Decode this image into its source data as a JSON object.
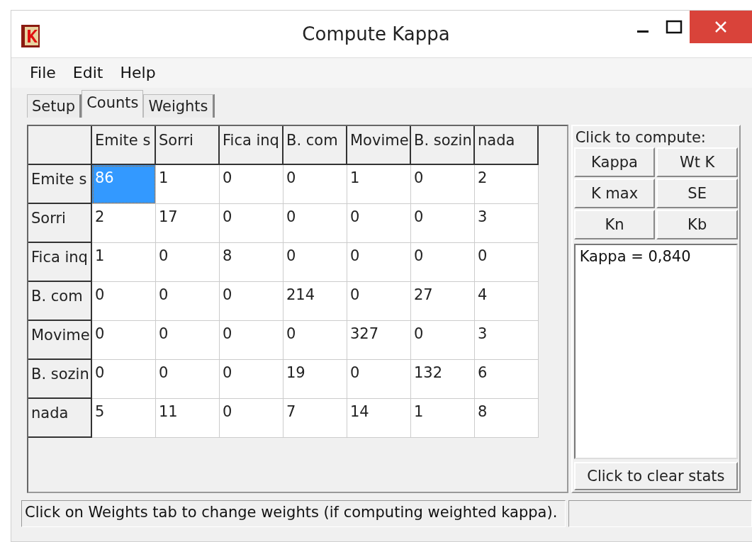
{
  "window": {
    "title": "Compute Kappa"
  },
  "menu": [
    "File",
    "Edit",
    "Help"
  ],
  "tabs": [
    {
      "label": "Setup",
      "selected": false
    },
    {
      "label": "Counts",
      "selected": true
    },
    {
      "label": "Weights",
      "selected": false
    }
  ],
  "grid": {
    "columns": [
      "Emite s",
      "Sorri",
      "Fica inq",
      "B. com",
      "Movime",
      "B. sozin",
      "nada"
    ],
    "rows": [
      {
        "header": "Emite s",
        "cells": [
          {
            "value": "86",
            "selected": true
          },
          {
            "value": "1",
            "selected": false
          },
          {
            "value": "0",
            "selected": false
          },
          {
            "value": "0",
            "selected": false
          },
          {
            "value": "1",
            "selected": false
          },
          {
            "value": "0",
            "selected": false
          },
          {
            "value": "2",
            "selected": false
          }
        ]
      },
      {
        "header": "Sorri",
        "cells": [
          {
            "value": "2",
            "selected": false
          },
          {
            "value": "17",
            "selected": false
          },
          {
            "value": "0",
            "selected": false
          },
          {
            "value": "0",
            "selected": false
          },
          {
            "value": "0",
            "selected": false
          },
          {
            "value": "0",
            "selected": false
          },
          {
            "value": "3",
            "selected": false
          }
        ]
      },
      {
        "header": "Fica inq",
        "cells": [
          {
            "value": "1",
            "selected": false
          },
          {
            "value": "0",
            "selected": false
          },
          {
            "value": "8",
            "selected": false
          },
          {
            "value": "0",
            "selected": false
          },
          {
            "value": "0",
            "selected": false
          },
          {
            "value": "0",
            "selected": false
          },
          {
            "value": "0",
            "selected": false
          }
        ]
      },
      {
        "header": "B. com",
        "cells": [
          {
            "value": "0",
            "selected": false
          },
          {
            "value": "0",
            "selected": false
          },
          {
            "value": "0",
            "selected": false
          },
          {
            "value": "214",
            "selected": false
          },
          {
            "value": "0",
            "selected": false
          },
          {
            "value": "27",
            "selected": false
          },
          {
            "value": "4",
            "selected": false
          }
        ]
      },
      {
        "header": "Movime",
        "cells": [
          {
            "value": "0",
            "selected": false
          },
          {
            "value": "0",
            "selected": false
          },
          {
            "value": "0",
            "selected": false
          },
          {
            "value": "0",
            "selected": false
          },
          {
            "value": "327",
            "selected": false
          },
          {
            "value": "0",
            "selected": false
          },
          {
            "value": "3",
            "selected": false
          }
        ]
      },
      {
        "header": "B. sozin",
        "cells": [
          {
            "value": "0",
            "selected": false
          },
          {
            "value": "0",
            "selected": false
          },
          {
            "value": "0",
            "selected": false
          },
          {
            "value": "19",
            "selected": false
          },
          {
            "value": "0",
            "selected": false
          },
          {
            "value": "132",
            "selected": false
          },
          {
            "value": "6",
            "selected": false
          }
        ]
      },
      {
        "header": "nada",
        "cells": [
          {
            "value": "5",
            "selected": false
          },
          {
            "value": "11",
            "selected": false
          },
          {
            "value": "0",
            "selected": false
          },
          {
            "value": "7",
            "selected": false
          },
          {
            "value": "14",
            "selected": false
          },
          {
            "value": "1",
            "selected": false
          },
          {
            "value": "8",
            "selected": false
          }
        ]
      }
    ]
  },
  "compute": {
    "label": "Click to compute:",
    "buttons": [
      "Kappa",
      "Wt K",
      "K max",
      "SE",
      "Kn",
      "Kb"
    ],
    "output": "Kappa = 0,840",
    "clear_button": "Click to clear stats"
  },
  "status_bar": {
    "text": "Click on Weights tab to change weights (if computing weighted kappa)."
  }
}
